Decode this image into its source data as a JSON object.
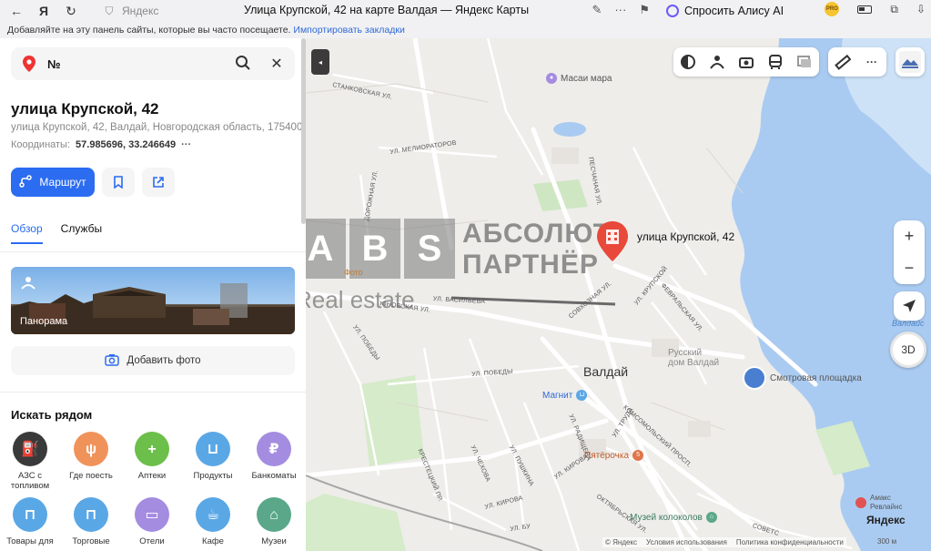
{
  "browser": {
    "site_host": "Яндекс",
    "tab_title": "Улица Крупской, 42 на карте Валдая — Яндекс Карты",
    "alice_label": "Спросить Алису AI",
    "pro_badge": "PRO"
  },
  "bookmarks": {
    "text": "Добавляйте на эту панель сайты, которые вы часто посещаете.",
    "import_link": "Импортировать закладки"
  },
  "search": {
    "value": "№"
  },
  "place": {
    "title": "улица Крупской, 42",
    "address": "улица Крупской, 42, Валдай, Новгородская область, 175400",
    "coords_label": "Координаты:",
    "coords_value": "57.985696, 33.246649",
    "coords_more": "···"
  },
  "actions": {
    "route_label": "Маршрут"
  },
  "tabs": [
    {
      "label": "Обзор"
    },
    {
      "label": "Службы"
    }
  ],
  "panorama": {
    "label": "Панорама"
  },
  "add_photo": {
    "label": "Добавить фото"
  },
  "nearby": {
    "title": "Искать рядом",
    "items": [
      {
        "label": "АЗС с топливом",
        "color": "#3a3a3a",
        "glyph": "⛽"
      },
      {
        "label": "Где поесть",
        "color": "#f0935a",
        "glyph": "🍴"
      },
      {
        "label": "Аптеки",
        "color": "#6cbf4a",
        "glyph": "+"
      },
      {
        "label": "Продукты",
        "color": "#5aa7e6",
        "glyph": "🛒"
      },
      {
        "label": "Банкоматы",
        "color": "#a48ce0",
        "glyph": "₽"
      },
      {
        "label": "Товары для",
        "color": "#5aa7e6",
        "glyph": "🛍"
      },
      {
        "label": "Торговые",
        "color": "#5aa7e6",
        "glyph": "🛍"
      },
      {
        "label": "Отели",
        "color": "#a48ce0",
        "glyph": "🛏"
      },
      {
        "label": "Кафе",
        "color": "#5aa7e6",
        "glyph": "☕"
      },
      {
        "label": "Музеи",
        "color": "#5aa889",
        "glyph": "🏛"
      }
    ]
  },
  "map": {
    "marker_label": "улица Крупской, 42",
    "city_label": "Валдай",
    "pois": [
      {
        "label": "Масаи мара",
        "color": "#a48ce0"
      },
      {
        "label": "Русский\nдом Валдай",
        "color": "#a4a4a4"
      },
      {
        "label": "Смотровая площадка",
        "color": "#4a7ed0"
      },
      {
        "label": "Магнит",
        "color": "#5aa7e6"
      },
      {
        "label": "Пятёрочка",
        "color": "#e0744a"
      },
      {
        "label": "Музей колоколов",
        "color": "#5aa889"
      },
      {
        "label": "Амакс\nРевлайнс",
        "color": "#e05454"
      },
      {
        "label": "Валдайс",
        "color": "#5aa7e6"
      }
    ],
    "streets": [
      {
        "label": "СТАНКОВСКАЯ УЛ."
      },
      {
        "label": "УЛ. МЕЛИОРАТОРОВ"
      },
      {
        "label": "ДОРОЖНАЯ УЛ."
      },
      {
        "label": "ПЕСЧАНАЯ УЛ."
      },
      {
        "label": "УЛ. ВАСИЛЬЕВА"
      },
      {
        "label": "ЮНОВСКАЯ УЛ."
      },
      {
        "label": "УЛ. ПОБЕДЫ"
      },
      {
        "label": "УЛ. ПОБЕДЫ"
      },
      {
        "label": "СОВХОЗНАЯ УЛ."
      },
      {
        "label": "УЛ. КРУПСКОЙ"
      },
      {
        "label": "ФЕВРАЛЬСКАЯ УЛ."
      },
      {
        "label": "КОМСОМОЛЬСКИЙ ПРОСП."
      },
      {
        "label": "УЛ. ТРУДА"
      },
      {
        "label": "УЛ. РАДИЩЕВА"
      },
      {
        "label": "УЛ. ПУШКИНА"
      },
      {
        "label": "УЛ. ЧЕХОВА"
      },
      {
        "label": "КРЕСТЕЦКИЙ ПР."
      },
      {
        "label": "УЛ. КИРОВА"
      },
      {
        "label": "УЛ. КИРОВА"
      },
      {
        "label": "ОКТЯБРЬСКАЯ УЛ."
      },
      {
        "label": "СОВЕТС"
      },
      {
        "label": "УЛ. БУ"
      }
    ],
    "threed_label": "3D",
    "watermark": {
      "letters": [
        "A",
        "B",
        "S"
      ],
      "line1": "АБСОЛЮТ",
      "line2": "ПАРТНЁР",
      "line3": "Real estate",
      "photo_label": "Фото"
    },
    "footer": [
      "© Яндекс",
      "Условия использования",
      "Политика конфиденциальности"
    ],
    "logo": "Яндекс",
    "scale": "300 м"
  }
}
